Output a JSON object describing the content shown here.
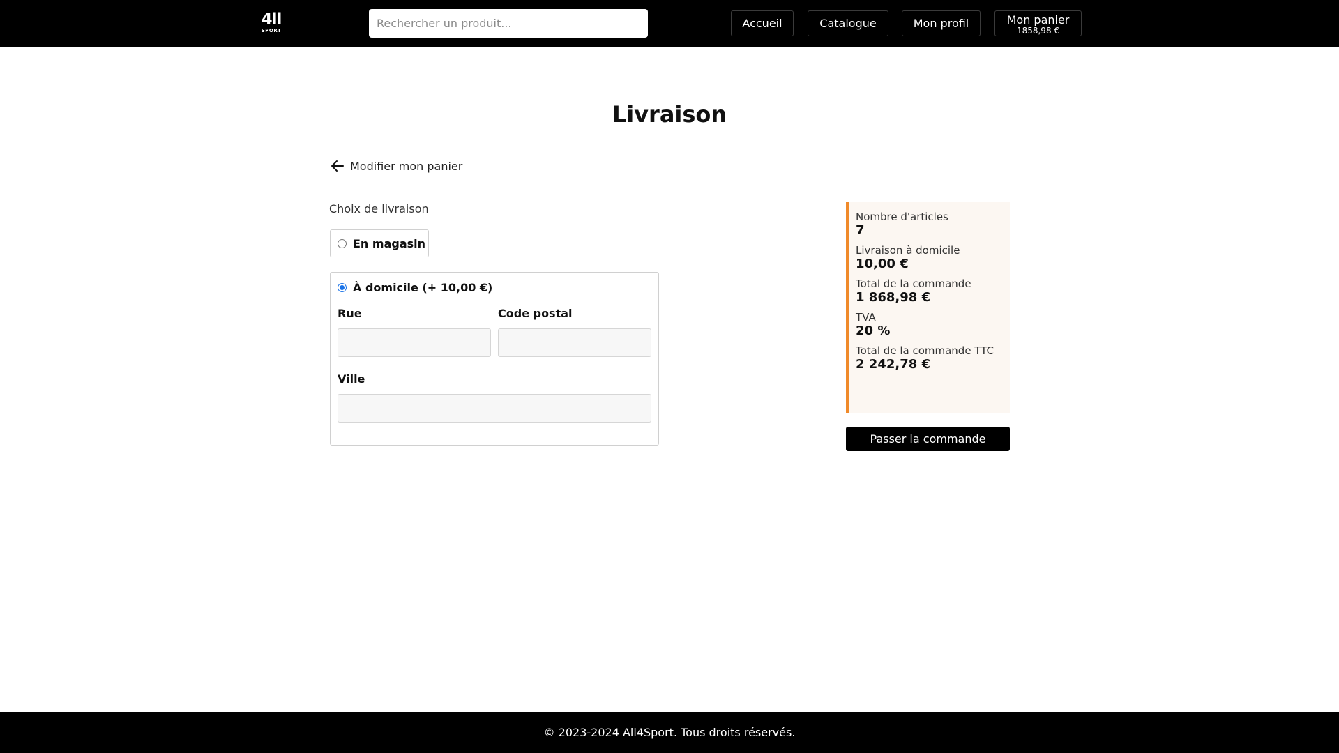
{
  "header": {
    "logo": {
      "main": "4ll",
      "sub": "SPORT"
    },
    "search": {
      "placeholder": "Rechercher un produit...",
      "value": ""
    },
    "nav": {
      "home": "Accueil",
      "catalog": "Catalogue",
      "profile": "Mon profil",
      "cart": "Mon panier",
      "cart_amount": "1858,98 €"
    }
  },
  "main": {
    "title": "Livraison",
    "back_link": "Modifier mon panier",
    "delivery_label": "Choix de livraison",
    "options": {
      "store": {
        "label": "En magasin",
        "selected": false
      },
      "home": {
        "label": "À domicile (+ 10,00 €)",
        "selected": true
      }
    },
    "fields": {
      "street": {
        "label": "Rue",
        "value": ""
      },
      "postal_code": {
        "label": "Code postal",
        "value": ""
      },
      "city": {
        "label": "Ville",
        "value": ""
      }
    }
  },
  "summary": {
    "items": [
      {
        "label": "Nombre d'articles",
        "value": "7"
      },
      {
        "label": "Livraison à domicile",
        "value": "10,00 €"
      },
      {
        "label": "Total de la commande",
        "value": "1 868,98 €"
      },
      {
        "label": "TVA",
        "value": "20 %"
      },
      {
        "label": "Total de la commande TTC",
        "value": "2 242,78 €"
      }
    ],
    "order_button": "Passer la commande"
  },
  "footer": {
    "text": "© 2023-2024 All4Sport. Tous droits réservés."
  },
  "colors": {
    "accent": "#f08a2a",
    "summary_bg": "#fcf7f2",
    "header_bg": "#000000",
    "radio_blue": "#1a73e8"
  },
  "icons": {
    "back": "arrow-left-icon"
  }
}
